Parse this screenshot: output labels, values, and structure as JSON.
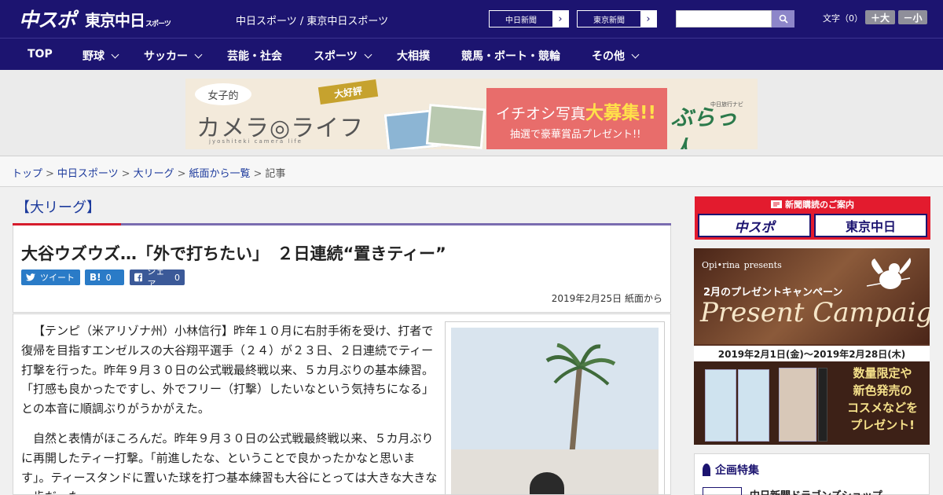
{
  "header": {
    "logo_main": "中スポ",
    "logo_tokyo": "東京中日",
    "logo_tokyo_small": "スポーツ",
    "site_names": "中日スポーツ / 東京中日スポーツ",
    "paper_links": [
      "中日新聞",
      "東京新聞"
    ],
    "search": {
      "placeholder": "",
      "value": ""
    },
    "font_size_label": "文字（0）",
    "font_larger": "＋大",
    "font_smaller": "－小"
  },
  "nav": {
    "items": [
      {
        "label": "TOP",
        "has_dropdown": false
      },
      {
        "label": "野球",
        "has_dropdown": true
      },
      {
        "label": "サッカー",
        "has_dropdown": true
      },
      {
        "label": "芸能・社会",
        "has_dropdown": false
      },
      {
        "label": "スポーツ",
        "has_dropdown": true
      },
      {
        "label": "大相撲",
        "has_dropdown": false
      },
      {
        "label": "競馬・ボート・競輪",
        "has_dropdown": false
      },
      {
        "label": "その他",
        "has_dropdown": true
      }
    ]
  },
  "banner": {
    "joshi": "女子的",
    "daihyo": "大好評",
    "camera_life": "カメラ◎ライフ",
    "subtitle": "jyoshiteki camera life",
    "campaign_line": "イチオシ写真",
    "campaign_big": "大募集!!",
    "prize_line": "抽選で豪華賞品プレゼント!!",
    "navi_label": "中日旅行ナビ",
    "navi_name": "ぶらっ人"
  },
  "breadcrumb": {
    "links": [
      "トップ",
      "中日スポーツ",
      "大リーグ",
      "紙面から一覧"
    ],
    "current": "記事"
  },
  "article": {
    "category": "【大リーグ】",
    "title": "大谷ウズウズ…「外で打ちたい」　２日連続“置きティー”",
    "share": {
      "tweet": "ツイート",
      "hatena_label": "B!",
      "hatena_count": "0",
      "facebook_label": "シェア",
      "facebook_count": "0"
    },
    "date": "2019年2月25日 紙面から",
    "paragraphs": [
      "【テンピ（米アリゾナ州）小林信行】昨年１０月に右肘手術を受け、打者で復帰を目指すエンゼルスの大谷翔平選手（２４）が２３日、２日連続でティー打撃を行った。昨年９月３０日の公式戦最終戦以来、５カ月ぶりの基本練習。「打感も良かったですし、外でフリー（打撃）したいなという気持ちになる」との本音に順調ぶりがうかがえた。",
      "自然と表情がほころんだ。昨年９月３０日の公式戦最終戦以来、５カ月ぶりに再開したティー打撃。「前進したな、ということで良かったかなと思います」。ティースタンドに置いた球を打つ基本練習も大谷にとっては大きな大きな一歩だった。"
    ]
  },
  "sidebar": {
    "subscription": {
      "header": "新聞購読のご案内",
      "logo_chuspo": "中スポ",
      "logo_tokyo": "東京中日"
    },
    "present_ad": {
      "brand": "Opi•rina",
      "brand_suffix": "presents",
      "campaign": "2月のプレゼントキャンペーン",
      "headline": "Present Campaign",
      "period": "2019年2月1日(金)～2019年2月28日(木)",
      "limited_1": "数量限定や",
      "limited_2": "新色発売の",
      "limited_3": "コスメなどを",
      "limited_4": "プレゼント!"
    },
    "kikaku": {
      "header": "企画特集",
      "first_item": "中日新聞ドラゴンズショップ"
    }
  },
  "colors": {
    "header_bg": "#1c1470",
    "accent_red": "#d61c2c",
    "link_blue": "#1c3a9c"
  }
}
